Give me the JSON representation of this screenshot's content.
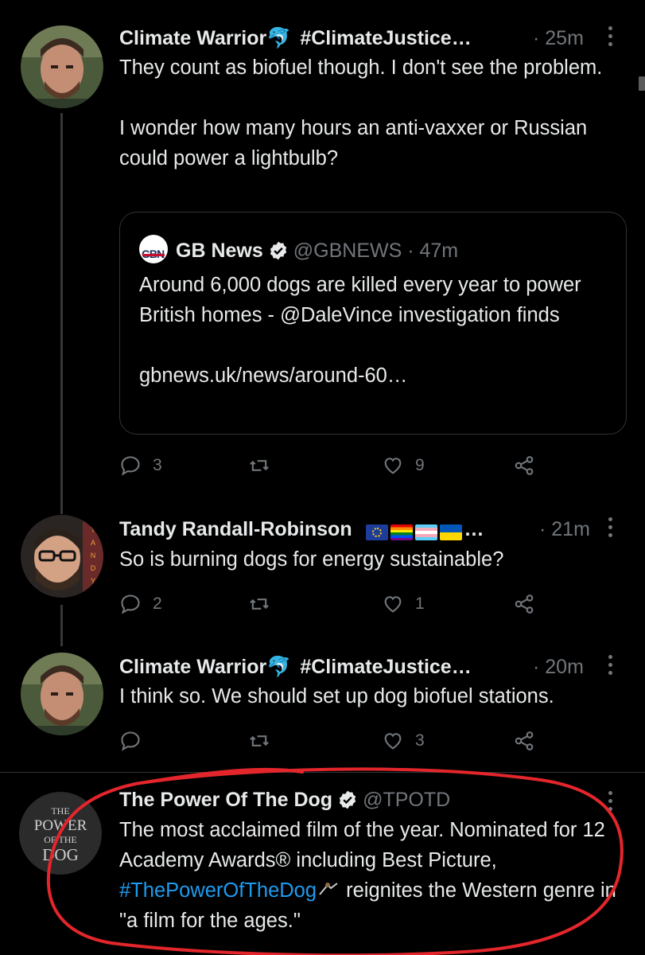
{
  "tweets": [
    {
      "name": "Climate Warrior",
      "name_suffix": "#ClimateJustice…",
      "time": "· 25m",
      "text": "They count as biofuel though. I don't see the problem.\n\nI wonder how many hours an anti-vaxxer or Russian could power a lightbulb?",
      "quote": {
        "logo": "GBN",
        "name": "GB News",
        "handle": "@GBNEWS · 47m",
        "text": "Around 6,000 dogs are killed every year to power British homes - @DaleVince investigation finds\n\ngbnews.uk/news/around-60…"
      },
      "replies": "3",
      "retweets": "",
      "likes": "9"
    },
    {
      "name": "Tandy Randall-Robinson",
      "time": "· 21m",
      "text": "So is burning dogs for energy sustainable?",
      "avatar_text": "TANDY",
      "replies": "2",
      "retweets": "",
      "likes": "1"
    },
    {
      "name": "Climate Warrior",
      "name_suffix": "#ClimateJustice…",
      "time": "· 20m",
      "text": "I think so. We should set up dog biofuel stations.",
      "replies": "",
      "retweets": "",
      "likes": "3"
    },
    {
      "name": "The Power Of The Dog",
      "handle": "@TPOTD",
      "text_before": "The most acclaimed film of the year. Nominated for 12 Academy Awards® including Best Picture, ",
      "hashtag": "#ThePowerOfTheDog",
      "text_after": " reignites the Western genre in \"a film for the ages.\"",
      "avatar_text": "THE POWER OF THE DOG"
    }
  ],
  "colors": {
    "background": "#000000",
    "text": "#e7e9ea",
    "muted": "#71767b",
    "link": "#1d9bf0",
    "verified": "#ffffff",
    "annotation": "#e3262b"
  }
}
